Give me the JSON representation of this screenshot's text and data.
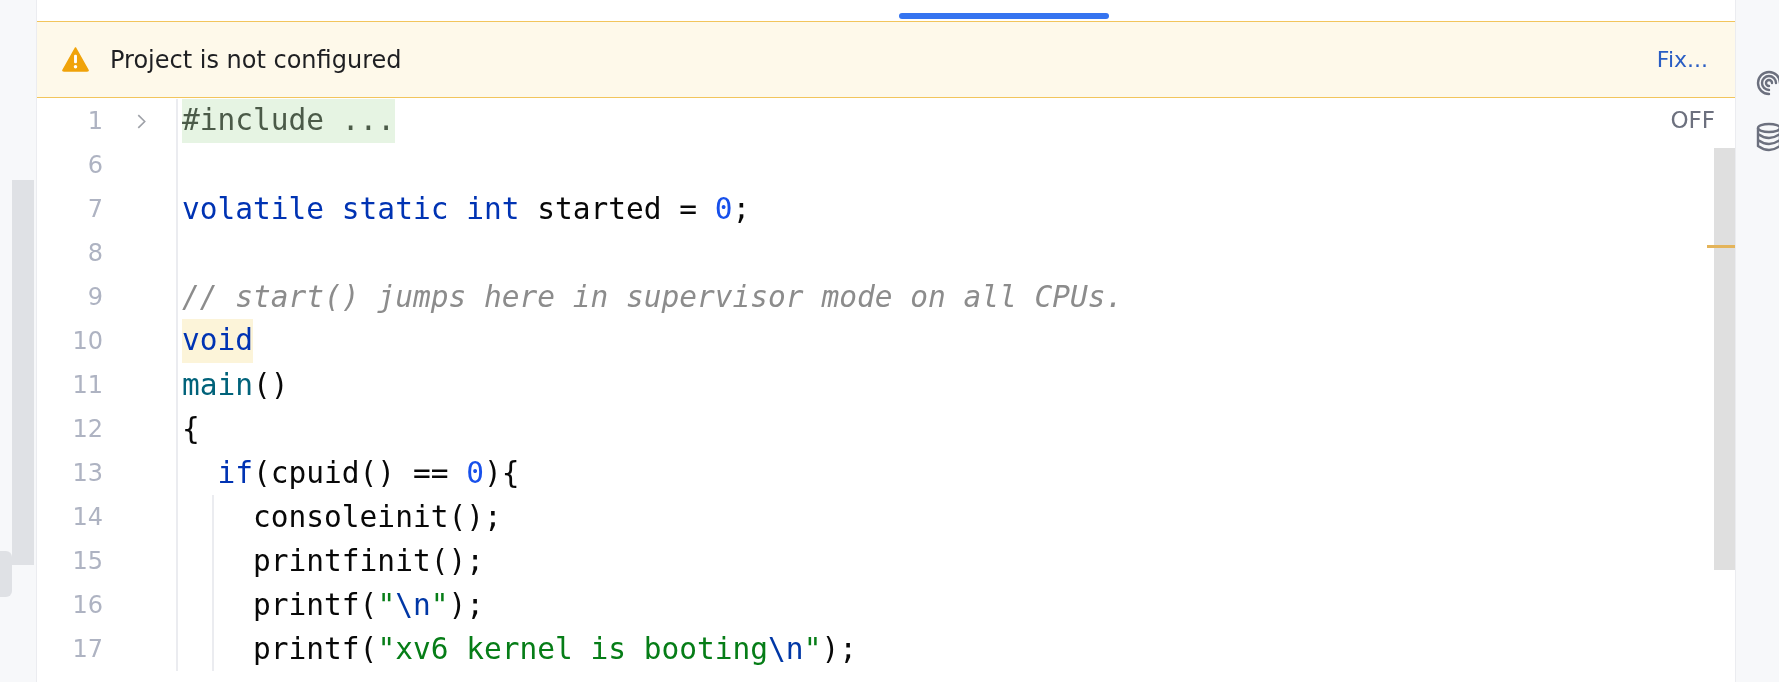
{
  "banner": {
    "message": "Project is not configured",
    "action": "Fix..."
  },
  "inspection_status": "OFF",
  "lines": [
    {
      "number": "1",
      "fold_marker": true,
      "indent_guide": false,
      "tokens": [
        {
          "kind": "fold",
          "text": "#include ..."
        }
      ]
    },
    {
      "number": "6",
      "fold_marker": false,
      "indent_guide": false
    },
    {
      "number": "7",
      "fold_marker": false,
      "indent_guide": false,
      "tokens": [
        {
          "kind": "keyword",
          "text": "volatile static int"
        },
        {
          "kind": "text",
          "text": " started = "
        },
        {
          "kind": "number",
          "text": "0"
        },
        {
          "kind": "text",
          "text": ";"
        }
      ]
    },
    {
      "number": "8",
      "fold_marker": false,
      "indent_guide": false
    },
    {
      "number": "9",
      "fold_marker": false,
      "indent_guide": false,
      "tokens": [
        {
          "kind": "comment",
          "text": "// start() jumps here in supervisor mode on all CPUs."
        }
      ]
    },
    {
      "number": "10",
      "fold_marker": false,
      "indent_guide": false,
      "tokens": [
        {
          "kind": "mark",
          "text": "void"
        }
      ]
    },
    {
      "number": "11",
      "fold_marker": false,
      "indent_guide": false,
      "tokens": [
        {
          "kind": "call",
          "text": "main"
        },
        {
          "kind": "text",
          "text": "()"
        }
      ]
    },
    {
      "number": "12",
      "fold_marker": false,
      "indent_guide": false,
      "tokens": [
        {
          "kind": "text",
          "text": "{"
        }
      ]
    },
    {
      "number": "13",
      "fold_marker": false,
      "indent_guide": false,
      "tokens": [
        {
          "kind": "keyword",
          "text": "  if"
        },
        {
          "kind": "text",
          "text": "(cpuid() == "
        },
        {
          "kind": "number",
          "text": "0"
        },
        {
          "kind": "text",
          "text": "){"
        }
      ]
    },
    {
      "number": "14",
      "fold_marker": false,
      "indent_guide": true,
      "tokens": [
        {
          "kind": "text",
          "text": "    consoleinit();"
        }
      ]
    },
    {
      "number": "15",
      "fold_marker": false,
      "indent_guide": true,
      "tokens": [
        {
          "kind": "text",
          "text": "    printfinit();"
        }
      ]
    },
    {
      "number": "16",
      "fold_marker": false,
      "indent_guide": true,
      "tokens": [
        {
          "kind": "text",
          "text": "    printf("
        },
        {
          "kind": "string",
          "text": "\""
        },
        {
          "kind": "escape",
          "text": "\\n"
        },
        {
          "kind": "string",
          "text": "\""
        },
        {
          "kind": "text",
          "text": ");"
        }
      ]
    },
    {
      "number": "17",
      "fold_marker": false,
      "indent_guide": true,
      "tokens": [
        {
          "kind": "text",
          "text": "    printf("
        },
        {
          "kind": "string",
          "text": "\"xv6 kernel is booting"
        },
        {
          "kind": "escape",
          "text": "\\n"
        },
        {
          "kind": "string",
          "text": "\""
        },
        {
          "kind": "text",
          "text": ");"
        }
      ]
    }
  ]
}
